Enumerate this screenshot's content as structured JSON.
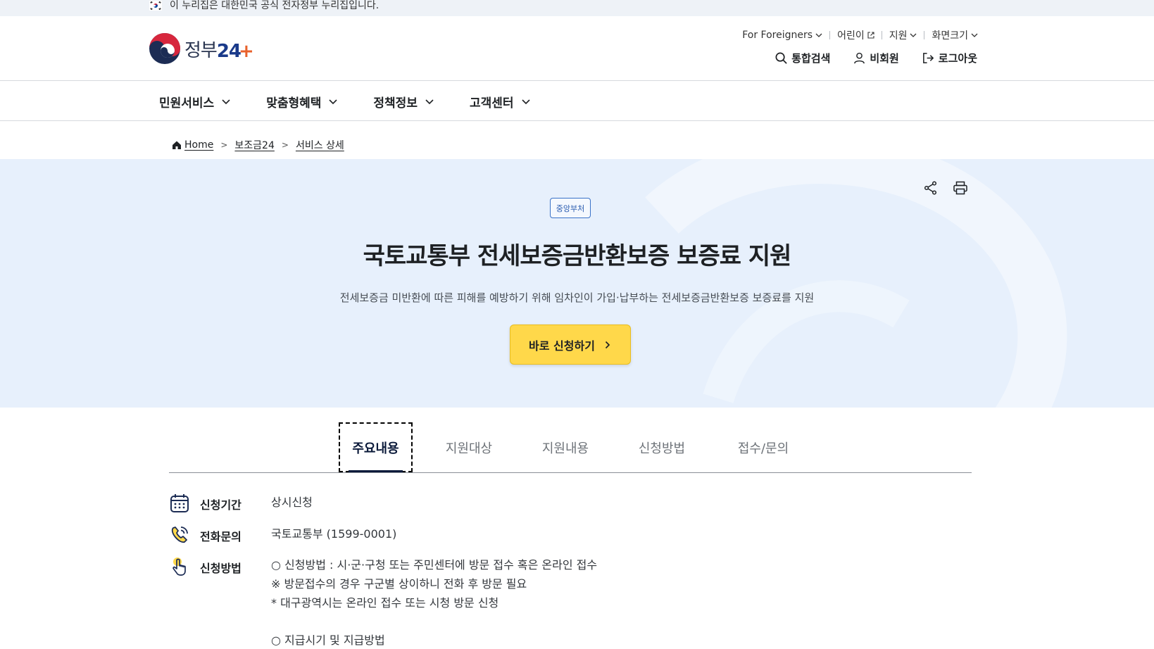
{
  "gov_banner": {
    "text": "이 누리집은 대한민국 공식 전자정부 누리집입니다."
  },
  "logo": {
    "name_ko": "정부",
    "name_num": "24",
    "plus": "+"
  },
  "util_menu": [
    {
      "label": "For Foreigners",
      "icon": "chevron-down-icon"
    },
    {
      "label": "어린이",
      "icon": "external-link-icon"
    },
    {
      "label": "지원",
      "icon": "chevron-down-icon"
    },
    {
      "label": "화면크기",
      "icon": "chevron-down-icon"
    }
  ],
  "actions": {
    "search": "통합검색",
    "guest": "비회원",
    "logout": "로그아웃"
  },
  "gnb": [
    {
      "label": "민원서비스"
    },
    {
      "label": "맞춤형혜택"
    },
    {
      "label": "정책정보"
    },
    {
      "label": "고객센터"
    }
  ],
  "breadcrumb": {
    "home": "Home",
    "level1": "보조금24",
    "level2": "서비스 상세"
  },
  "hero": {
    "badge": "중앙부처",
    "title": "국토교통부 전세보증금반환보증 보증료 지원",
    "subtitle": "전세보증금 미반환에 따른 피해를 예방하기 위해 임차인이 가입·납부하는 전세보증금반환보증 보증료를 지원",
    "apply_label": "바로 신청하기"
  },
  "tabs": [
    {
      "label": "주요내용",
      "active": true
    },
    {
      "label": "지원대상",
      "active": false
    },
    {
      "label": "지원내용",
      "active": false
    },
    {
      "label": "신청방법",
      "active": false
    },
    {
      "label": "접수/문의",
      "active": false
    }
  ],
  "info": {
    "period": {
      "label": "신청기간",
      "value": "상시신청"
    },
    "phone": {
      "label": "전화문의",
      "value": "국토교통부 (1599-0001)"
    },
    "method": {
      "label": "신청방법",
      "lines": [
        "○ 신청방법 : 시·군·구청 또는 주민센터에 방문 접수 혹은 온라인 접수",
        "※ 방문접수의 경우 구군별 상이하니 전화 후 방문 필요",
        "* 대구광역시는 온라인 접수 또는 시청 방문 신청",
        "",
        "○ 지급시기 및 지급방법"
      ]
    }
  },
  "colors": {
    "accent_navy": "#1c2c54",
    "hero_bg": "#e7f0fc",
    "apply_yellow": "#ffd84a",
    "badge_blue": "#3a72c8",
    "logo_plus": "#e8612b"
  }
}
